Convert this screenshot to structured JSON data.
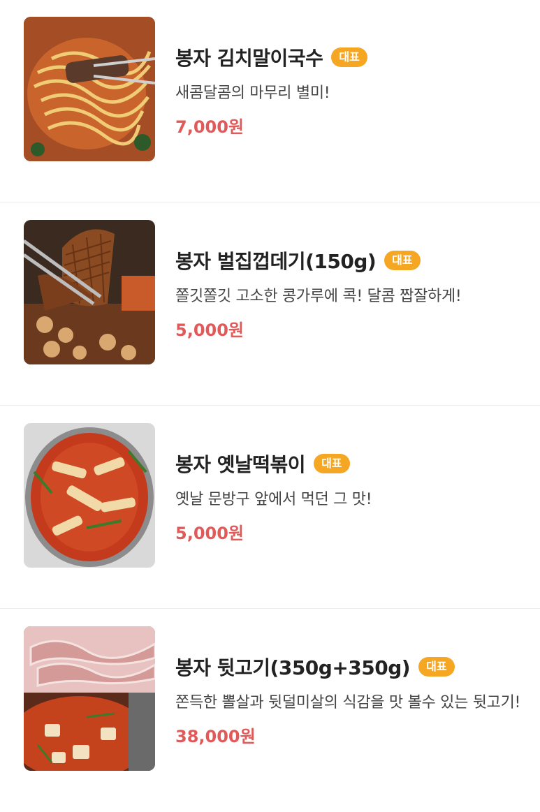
{
  "menu": {
    "badge_color": "#f5a623",
    "price_color": "#e05a5a",
    "items": [
      {
        "image_icon": "noodle-photo",
        "title": "봉자 김치말이국수",
        "badge": "대표",
        "description": "새콤달콤의 마무리 별미!",
        "price": "7,000원"
      },
      {
        "image_icon": "pork-skin-photo",
        "title": "봉자 벌집껍데기(150g)",
        "badge": "대표",
        "description": "쫄깃쫄깃 고소한 콩가루에 콕! 달콤 짭잘하게!",
        "price": "5,000원"
      },
      {
        "image_icon": "tteokbokki-photo",
        "title": "봉자 옛날떡볶이",
        "badge": "대표",
        "description": "옛날 문방구 앞에서 먹던 그 맛!",
        "price": "5,000원"
      },
      {
        "image_icon": "pork-meat-photo",
        "title": "봉자 뒷고기(350g+350g)",
        "badge": "대표",
        "description": "쫀득한 뽈살과 뒷덜미살의 식감을 맛 볼수 있는 뒷고기!",
        "price": "38,000원"
      }
    ]
  }
}
